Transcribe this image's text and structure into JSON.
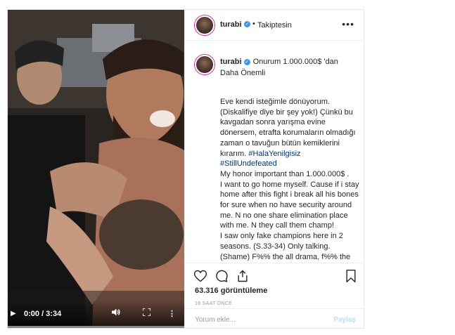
{
  "post": {
    "username": "turabi",
    "separator": "•",
    "follow_status": "Takiptesin",
    "more_icon": "more-horizontal-icon",
    "caption_title": "Onurum 1.000.000$ 'dan Daha Önemli",
    "caption_tr": "Eve kendi isteğimle dönüyorum. (Diskalifiye diye bir şey yok!) Çünkü bu kavgadan sonra yarışma evine dönersem, etrafta korumaların olmadığı zaman o tavuğun bütün kemiklerini kırarım.",
    "hashtag_1": "#HalaYenilgisiz",
    "hashtag_2": "#StillUndefeated",
    "caption_en": "My honor important than 1.000.000$ .\nI want to go home myself. Cause if i stay home after this fight i break all his bones for sure when no have security around me. N no one share elimination place with me. N they call them champ!\nI saw only fake champions here in 2 seasons. (S.33-34) Only talking. (Shame) F%% the all drama, f%% the all",
    "views": "63.316 görüntüleme",
    "time_ago": "16 SAAT ÖNCE",
    "comment_placeholder": "Yorum ekle...",
    "comment_button": "Paylaş"
  },
  "video": {
    "play_icon": "play-icon",
    "time": "0:00 / 3:34",
    "progress": 0,
    "volume_icon": "volume-icon",
    "fullscreen_icon": "fullscreen-icon",
    "more_icon": "more-vertical-icon"
  },
  "colors": {
    "verified": "#3897f0",
    "hashtag": "#003569",
    "muted": "#999999",
    "disabled_button": "#b2dffc"
  }
}
